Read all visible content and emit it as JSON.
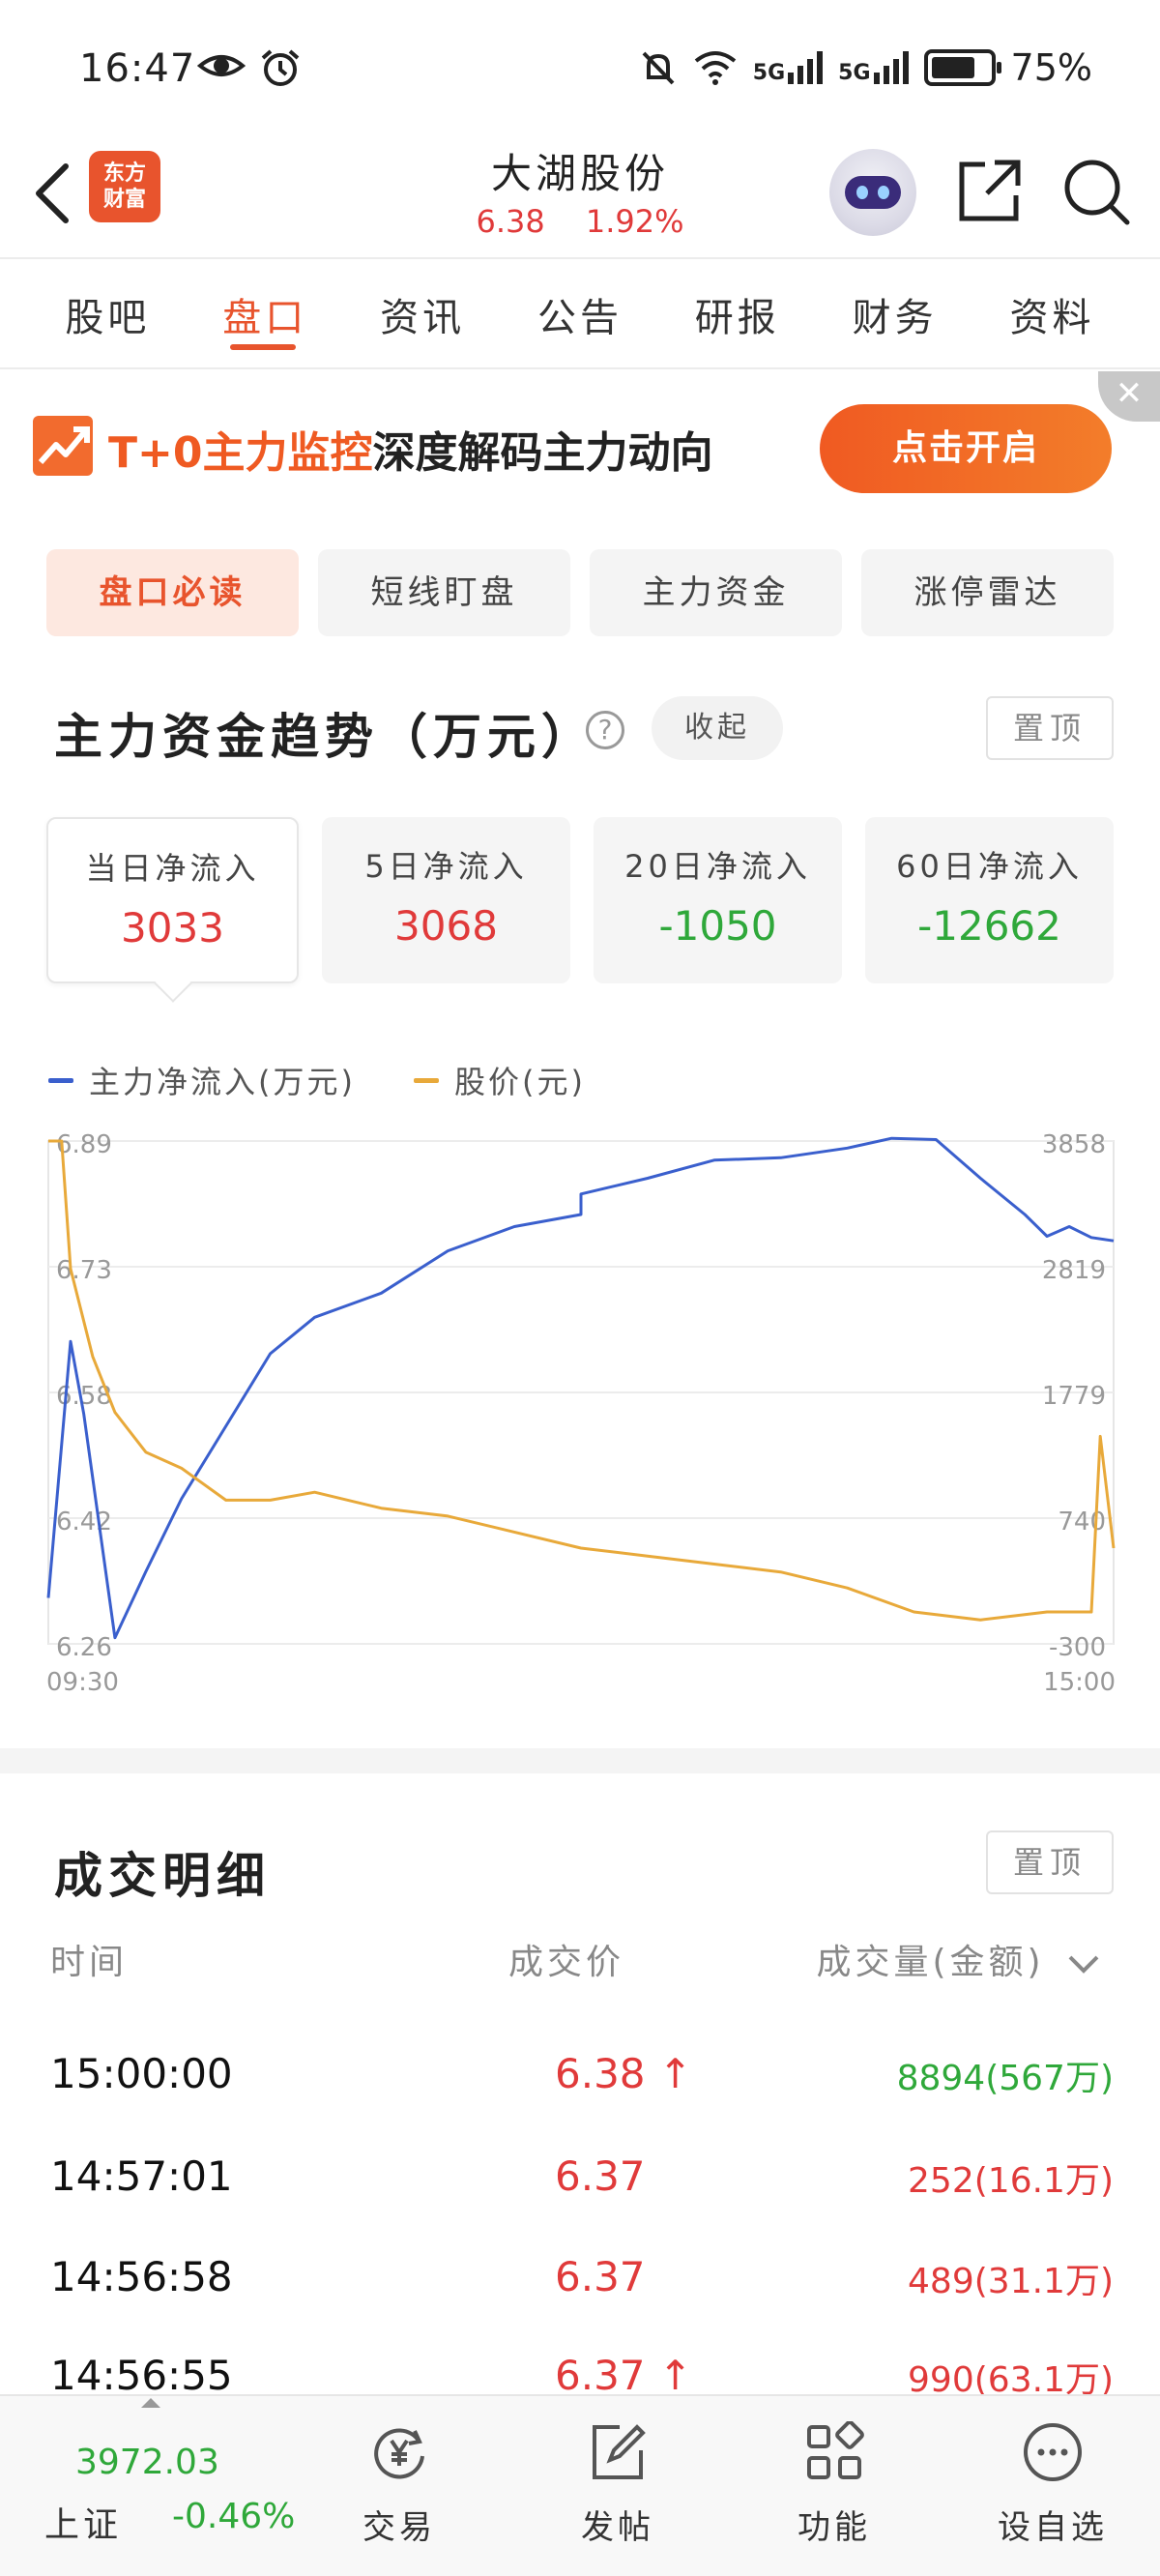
{
  "status_bar": {
    "time": "16:47",
    "net1": "5G",
    "net2": "5G",
    "battery": "75%",
    "battery_level": 0.75
  },
  "header": {
    "logo_line1": "东方",
    "logo_line2": "财富",
    "stock_name": "大湖股份",
    "price": "6.38",
    "change_pct": "1.92%"
  },
  "tabs": [
    "股吧",
    "盘口",
    "资讯",
    "公告",
    "研报",
    "财务",
    "资料"
  ],
  "banner": {
    "close": "✕",
    "highlight": "T+0主力监控",
    "text": "深度解码主力动向",
    "button": "点击开启"
  },
  "subtabs": [
    "盘口必读",
    "短线盯盘",
    "主力资金",
    "涨停雷达"
  ],
  "fund_section": {
    "title": "主力资金趋势（万元）",
    "help": "?",
    "collapse": "收起",
    "pin": "置顶",
    "cards": [
      {
        "label": "当日净流入",
        "value": "3033",
        "color": "red"
      },
      {
        "label": "5日净流入",
        "value": "3068",
        "color": "red"
      },
      {
        "label": "20日净流入",
        "value": "-1050",
        "color": "green"
      },
      {
        "label": "60日净流入",
        "value": "-12662",
        "color": "green"
      }
    ]
  },
  "chart_data": {
    "type": "line",
    "series": [
      {
        "name": "主力净流入(万元)",
        "color": "#3a5fcd",
        "axis": "right",
        "x": [
          "09:30",
          "09:35",
          "09:38",
          "09:45",
          "09:52",
          "10:00",
          "10:10",
          "10:20",
          "10:30",
          "10:45",
          "11:00",
          "11:15",
          "11:30",
          "13:00",
          "13:15",
          "13:30",
          "13:45",
          "14:00",
          "14:10",
          "14:20",
          "14:30",
          "14:40",
          "14:45",
          "14:50",
          "14:55",
          "15:00"
        ],
        "values": [
          80,
          2200,
          1600,
          -250,
          300,
          900,
          1500,
          2100,
          2400,
          2600,
          2950,
          3150,
          3250,
          3420,
          3550,
          3700,
          3720,
          3800,
          3880,
          3870,
          3550,
          3250,
          3070,
          3150,
          3060,
          3033
        ]
      },
      {
        "name": "股价(元)",
        "color": "#e8a93a",
        "axis": "left",
        "x": [
          "09:30",
          "09:31",
          "09:33",
          "09:35",
          "09:40",
          "09:45",
          "09:52",
          "10:00",
          "10:10",
          "10:20",
          "10:30",
          "10:45",
          "11:00",
          "11:15",
          "11:30",
          "13:00",
          "13:15",
          "13:30",
          "13:45",
          "14:00",
          "14:15",
          "14:30",
          "14:45",
          "14:55",
          "14:57",
          "15:00"
        ],
        "values": [
          6.89,
          6.89,
          6.89,
          6.73,
          6.62,
          6.55,
          6.5,
          6.48,
          6.44,
          6.44,
          6.45,
          6.43,
          6.42,
          6.4,
          6.38,
          6.38,
          6.37,
          6.36,
          6.35,
          6.33,
          6.3,
          6.29,
          6.3,
          6.3,
          6.52,
          6.38
        ]
      }
    ],
    "left_ticks": [
      "6.89",
      "6.73",
      "6.58",
      "6.42",
      "6.26"
    ],
    "right_ticks": [
      "3858",
      "2819",
      "1779",
      "740",
      "-300"
    ],
    "left_range": [
      6.26,
      6.89
    ],
    "right_range": [
      -300,
      3858
    ],
    "x_start": "09:30",
    "x_end": "15:00",
    "grid": true
  },
  "trades_section": {
    "title": "成交明细",
    "pin": "置顶",
    "col_time": "时间",
    "col_price": "成交价",
    "col_volume": "成交量(金额)",
    "rows": [
      {
        "time": "15:00:00",
        "price": "6.38 ↑",
        "volume": "8894(567万)",
        "vol_color": "green"
      },
      {
        "time": "14:57:01",
        "price": "6.37",
        "volume": "252(16.1万)",
        "vol_color": "red"
      },
      {
        "time": "14:56:58",
        "price": "6.37",
        "volume": "489(31.1万)",
        "vol_color": "red"
      },
      {
        "time": "14:56:55",
        "price": "6.37 ↑",
        "volume": "990(63.1万)",
        "vol_color": "red"
      }
    ]
  },
  "bottom_nav": {
    "index_value": "3972.03",
    "index_name": "上证",
    "index_change": "-0.46%",
    "items": [
      "交易",
      "发帖",
      "功能",
      "设自选"
    ]
  }
}
